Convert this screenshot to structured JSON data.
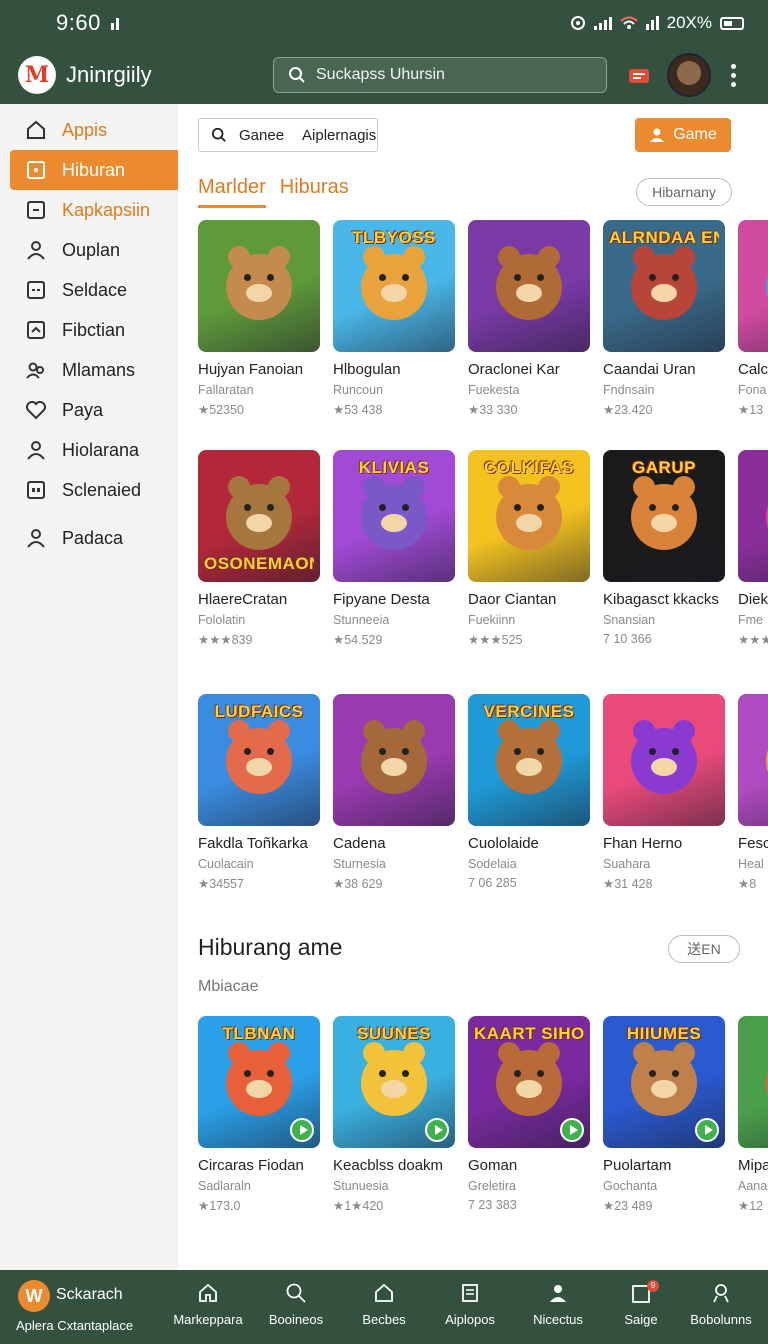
{
  "status_bar": {
    "time": "9:60",
    "battery": "20X%"
  },
  "app_bar": {
    "logo_letter": "M",
    "brand": "Jninrgiily",
    "search_placeholder": "Suckapss Uhursin"
  },
  "sidebar": {
    "items": [
      {
        "label": "Appis",
        "icon": "home-icon"
      },
      {
        "label": "Hiburan",
        "icon": "square-dot-icon",
        "active": true
      },
      {
        "label": "Kapkapsiin",
        "icon": "square-dash-icon"
      },
      {
        "label": "Ouplan",
        "icon": "person-icon"
      },
      {
        "label": "Seldace",
        "icon": "grid-box-icon"
      },
      {
        "label": "Fibctian",
        "icon": "chevron-box-icon"
      },
      {
        "label": "Mlamans",
        "icon": "group-icon"
      },
      {
        "label": "Paya",
        "icon": "heart-icon"
      },
      {
        "label": "Hiolarana",
        "icon": "person-icon"
      },
      {
        "label": "Sclenaied",
        "icon": "dots-box-icon"
      },
      {
        "label": "Padaca",
        "icon": "person-icon"
      }
    ]
  },
  "main": {
    "filter": {
      "left": "Ganee",
      "right": "Aiplernagis"
    },
    "game_button": "Game",
    "tabs": [
      "Marlder",
      "Hiburas"
    ],
    "tab_pill": "Hibarnany",
    "section_title": "Hiburang ame",
    "section_sub": "Mbiacae",
    "section_pill": "送EN",
    "rows": [
      [
        {
          "name": "Hujyan Fanoian",
          "sub": "Fallaratan",
          "meta": "★52350",
          "title": "",
          "colors": [
            "#5f9a3a",
            "#c48b4f"
          ]
        },
        {
          "name": "Hlbogulan",
          "sub": "Runcoun",
          "meta": "★53 438",
          "title": "TLBYOSS",
          "colors": [
            "#49b7e8",
            "#e9a33c"
          ]
        },
        {
          "name": "Oraclonei Kar",
          "sub": "Fuekesta",
          "meta": "★33 330",
          "title": "",
          "colors": [
            "#7a3aa6",
            "#b06a35"
          ]
        },
        {
          "name": "Caandai Uran",
          "sub": "Fndnsain",
          "meta": "★23.420",
          "title": "ALRNDAA ENAAEH",
          "colors": [
            "#3a6a8a",
            "#b8453a"
          ]
        },
        {
          "name": "Calc",
          "sub": "Fona",
          "meta": "★13",
          "title": "",
          "colors": [
            "#d04aa0",
            "#4aa0d0"
          ]
        }
      ],
      [
        {
          "name": "HlaereCratan",
          "sub": "Fololatin",
          "meta": "★★★839",
          "title": "OSONEMAONI",
          "colors": [
            "#b2283a",
            "#a5763e"
          ]
        },
        {
          "name": "Fipyane Desta",
          "sub": "Stunneeia",
          "meta": "★54.529",
          "title": "KLIVIAS",
          "colors": [
            "#a24ad6",
            "#7a58c8"
          ]
        },
        {
          "name": "Daor Ciantan",
          "sub": "Fuekiinn",
          "meta": "★★★525",
          "title": "COLKIFAS",
          "colors": [
            "#f2c21f",
            "#d88a3a"
          ]
        },
        {
          "name": "Kibagasct kkacks",
          "sub": "Snansian",
          "meta": "7 10 366",
          "title": "GARUP",
          "colors": [
            "#1b1b1b",
            "#d8823a"
          ]
        },
        {
          "name": "Diek",
          "sub": "Fme",
          "meta": "★★★",
          "title": "",
          "colors": [
            "#8a2f9a",
            "#d04aa0"
          ]
        }
      ],
      [
        {
          "name": "Fakdla Toñkarka",
          "sub": "Cuolacain",
          "meta": "★34557",
          "title": "LUDFAICS",
          "colors": [
            "#3a8ce0",
            "#e36a4a"
          ]
        },
        {
          "name": "Cadena",
          "sub": "Sturnesia",
          "meta": "★38 629",
          "title": "",
          "colors": [
            "#9a3ab0",
            "#a4683a"
          ]
        },
        {
          "name": "Cuololaide",
          "sub": "Sodelaia",
          "meta": "7 06 285",
          "title": "VERCINES",
          "colors": [
            "#1f9ad6",
            "#b4703a"
          ]
        },
        {
          "name": "Fhan Herno",
          "sub": "Suahara",
          "meta": "★31 428",
          "title": "",
          "colors": [
            "#e94a7a",
            "#8a3ad0"
          ]
        },
        {
          "name": "Fesc",
          "sub": "Heal",
          "meta": "★8",
          "title": "",
          "colors": [
            "#b04ac0",
            "#e9a33c"
          ]
        }
      ],
      [
        {
          "name": "Circaras Fiodan",
          "sub": "Sadlaraln",
          "meta": "★173.0",
          "title": "TLBNAN",
          "colors": [
            "#2aa0e8",
            "#e8603a"
          ]
        },
        {
          "name": "Keacblss doakm",
          "sub": "Stunuesia",
          "meta": "★1★420",
          "title": "SUUNES",
          "colors": [
            "#3ab0e0",
            "#f2c23a"
          ]
        },
        {
          "name": "Goman",
          "sub": "Greletira",
          "meta": "7 23 383",
          "title": "KAART SIHOKAS",
          "colors": [
            "#7a2aa0",
            "#b86a3a"
          ]
        },
        {
          "name": "Puolartam",
          "sub": "Gochanta",
          "meta": "★23 489",
          "title": "HIIUMES",
          "colors": [
            "#2a5ad0",
            "#c0804a"
          ]
        },
        {
          "name": "Mipa",
          "sub": "Aana",
          "meta": "★12",
          "title": "",
          "colors": [
            "#4aa04a",
            "#e8603a"
          ]
        }
      ]
    ]
  },
  "bottom_nav": {
    "home": {
      "letter": "W",
      "title": "Sckarach",
      "subtitle": "Aplera Cxtantaplace"
    },
    "items": [
      {
        "label": "Markeppara",
        "icon": "home-outline-icon"
      },
      {
        "label": "Booineos",
        "icon": "search-icon"
      },
      {
        "label": "Becbes",
        "icon": "house-icon"
      },
      {
        "label": "Aiplopos",
        "icon": "document-icon"
      },
      {
        "label": "Nicectus",
        "icon": "person-icon"
      },
      {
        "label": "Saige",
        "icon": "bag-icon",
        "badge": "9"
      },
      {
        "label": "Bobolunns",
        "icon": "account-icon"
      }
    ]
  }
}
